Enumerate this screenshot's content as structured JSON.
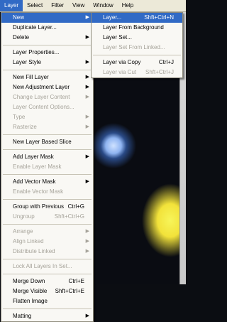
{
  "menubar": {
    "items": [
      "Layer",
      "Select",
      "Filter",
      "View",
      "Window",
      "Help"
    ],
    "active": "Layer"
  },
  "layer_menu": {
    "items": [
      {
        "label": "New",
        "submenu": true,
        "highlighted": true
      },
      {
        "label": "Duplicate Layer..."
      },
      {
        "label": "Delete",
        "submenu": true
      },
      {
        "sep": true
      },
      {
        "label": "Layer Properties..."
      },
      {
        "label": "Layer Style",
        "submenu": true
      },
      {
        "sep": true
      },
      {
        "label": "New Fill Layer",
        "submenu": true
      },
      {
        "label": "New Adjustment Layer",
        "submenu": true
      },
      {
        "label": "Change Layer Content",
        "submenu": true,
        "disabled": true
      },
      {
        "label": "Layer Content Options...",
        "disabled": true
      },
      {
        "label": "Type",
        "submenu": true,
        "disabled": true
      },
      {
        "label": "Rasterize",
        "submenu": true,
        "disabled": true
      },
      {
        "sep": true
      },
      {
        "label": "New Layer Based Slice"
      },
      {
        "sep": true
      },
      {
        "label": "Add Layer Mask",
        "submenu": true
      },
      {
        "label": "Enable Layer Mask",
        "disabled": true
      },
      {
        "sep": true
      },
      {
        "label": "Add Vector Mask",
        "submenu": true
      },
      {
        "label": "Enable Vector Mask",
        "disabled": true
      },
      {
        "sep": true
      },
      {
        "label": "Group with Previous",
        "shortcut": "Ctrl+G"
      },
      {
        "label": "Ungroup",
        "shortcut": "Shft+Ctrl+G",
        "disabled": true
      },
      {
        "sep": true
      },
      {
        "label": "Arrange",
        "submenu": true,
        "disabled": true
      },
      {
        "label": "Align Linked",
        "submenu": true,
        "disabled": true
      },
      {
        "label": "Distribute Linked",
        "submenu": true,
        "disabled": true
      },
      {
        "sep": true
      },
      {
        "label": "Lock All Layers In Set...",
        "disabled": true
      },
      {
        "sep": true
      },
      {
        "label": "Merge Down",
        "shortcut": "Ctrl+E"
      },
      {
        "label": "Merge Visible",
        "shortcut": "Shft+Ctrl+E"
      },
      {
        "label": "Flatten Image"
      },
      {
        "sep": true
      },
      {
        "label": "Matting",
        "submenu": true
      }
    ]
  },
  "new_submenu": {
    "items": [
      {
        "label": "Layer...",
        "shortcut": "Shft+Ctrl+N",
        "highlighted": true
      },
      {
        "label": "Layer From Background"
      },
      {
        "label": "Layer Set..."
      },
      {
        "label": "Layer Set From Linked...",
        "disabled": true
      },
      {
        "sep": true
      },
      {
        "label": "Layer via Copy",
        "shortcut": "Ctrl+J"
      },
      {
        "label": "Layer via Cut",
        "shortcut": "Shft+Ctrl+J",
        "disabled": true
      }
    ]
  },
  "colors": {
    "highlight": "#316ac5",
    "menu_bg": "#f9f8f4",
    "disabled_text": "#a6a39a",
    "menubar_bg": "#ece9d8"
  }
}
